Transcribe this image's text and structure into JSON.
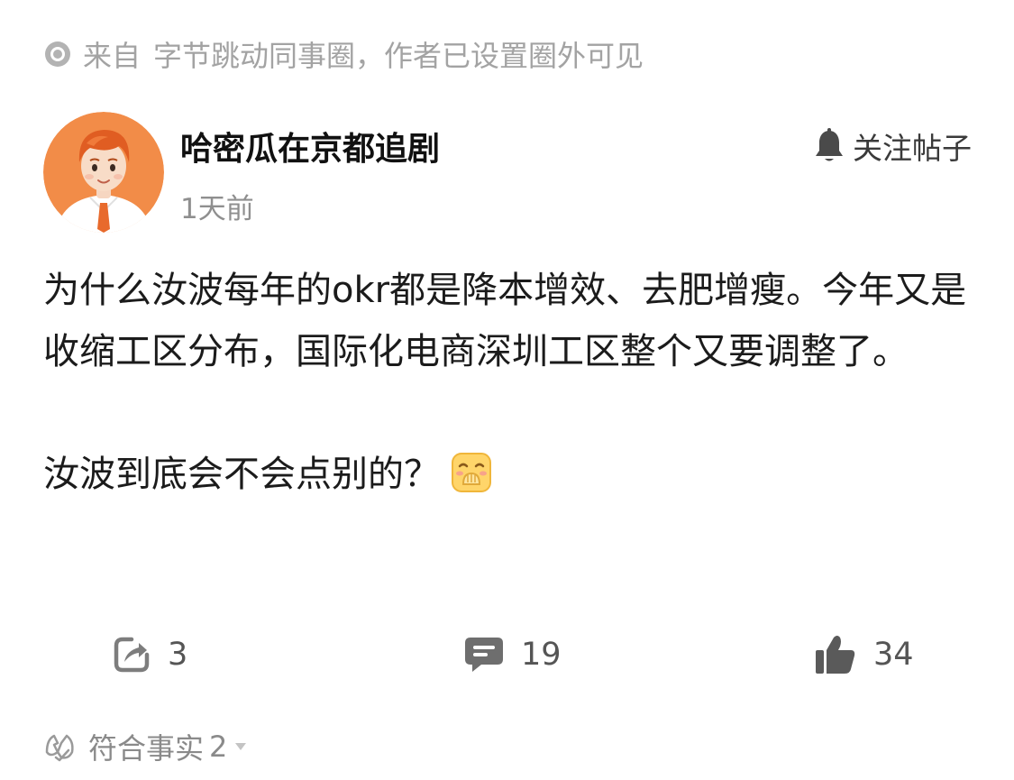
{
  "source": {
    "prefix": "来自",
    "circle": "字节跳动同事圈",
    "suffix": "，作者已设置圈外可见",
    "icon": "radio-dot-icon"
  },
  "author": {
    "name": "哈密瓜在京都追剧",
    "time": "1天前",
    "avatar_icon": "cartoon-avatar",
    "avatar_color": "#f28c48"
  },
  "follow": {
    "label": "关注帖子",
    "icon": "bell-icon"
  },
  "post": {
    "paragraph1": "为什么汝波每年的okr都是降本增效、去肥增瘦。今年又是收缩工区分布，国际化电商深圳工区整个又要调整了。",
    "paragraph2": "汝波到底会不会点别的？",
    "emoji": "covering-mouth-emoji"
  },
  "actions": {
    "share_count": "3",
    "comment_count": "19",
    "like_count": "34",
    "share_icon": "share-icon",
    "comment_icon": "comment-icon",
    "like_icon": "thumbs-up-icon"
  },
  "fact": {
    "label": "符合事实",
    "count": "2",
    "icon": "fact-check-icon",
    "caret_icon": "caret-down-icon"
  }
}
